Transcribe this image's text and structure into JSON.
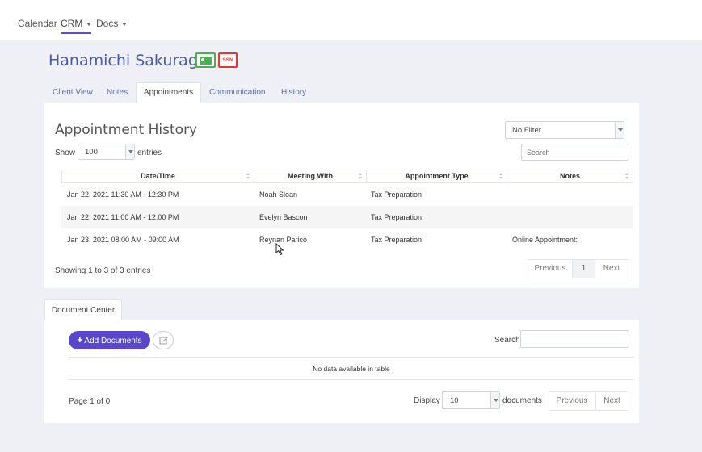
{
  "nav": {
    "calendar": "Calendar",
    "crm": "CRM",
    "docs": "Docs"
  },
  "client": {
    "name": "Hanamichi Sakuragi",
    "ssn_badge": "SSN"
  },
  "tabs": [
    "Client View",
    "Notes",
    "Appointments",
    "Communication",
    "History"
  ],
  "appointments": {
    "title": "Appointment History",
    "filter_value": "No Filter",
    "show_label": "Show",
    "page_size": "100",
    "entries_label": "entries",
    "search_placeholder": "Search",
    "columns": [
      "Date/Time",
      "Meeting With",
      "Appointment Type",
      "Notes"
    ],
    "rows": [
      {
        "datetime": "Jan 22, 2021 11:30 AM - 12:30 PM",
        "meeting_with": "Noah Sloan",
        "type": "Tax Preparation",
        "notes": ""
      },
      {
        "datetime": "Jan 22, 2021 11:00 AM - 12:00 PM",
        "meeting_with": "Evelyn Bascon",
        "type": "Tax Preparation",
        "notes": ""
      },
      {
        "datetime": "Jan 23, 2021 08:00 AM - 09:00 AM",
        "meeting_with": "Reynan Parico",
        "type": "Tax Preparation",
        "notes": "Online Appointment:"
      }
    ],
    "summary": "Showing 1 to 3 of 3 entries",
    "pagination": {
      "previous": "Previous",
      "current": "1",
      "next": "Next"
    }
  },
  "documents": {
    "tab_label": "Document Center",
    "add_button": "Add Documents",
    "search_label": "Search:",
    "empty_message": "No data available in table",
    "page_info": "Page 1 of 0",
    "display_label": "Display",
    "display_value": "10",
    "documents_label": "documents",
    "previous": "Previous",
    "next": "Next"
  },
  "colors": {
    "accent": "#5946c8",
    "link": "#5a6fb0",
    "client_name": "#4a5aa8",
    "id_badge": "#4caf50",
    "ssn_badge": "#e53935",
    "page_bg": "#eef0f5"
  },
  "icons": [
    "caret-down-icon",
    "id-card-icon",
    "ssn-icon",
    "sort-icon",
    "plus-icon",
    "edit-icon",
    "mouse-cursor-icon"
  ]
}
